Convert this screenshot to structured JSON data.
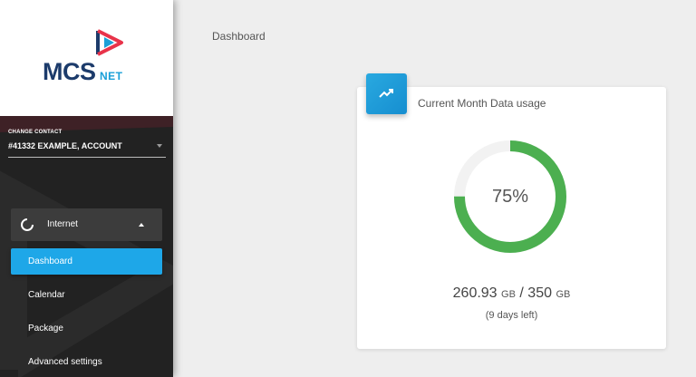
{
  "app": {
    "logo_text": "MCS",
    "logo_sub": "NET"
  },
  "sidebar": {
    "contact_label": "CHANGE CONTACT",
    "contact_value": "#41332 EXAMPLE, ACCOUNT",
    "group": {
      "label": "Internet",
      "icon": "loading-circle-icon",
      "expanded": true
    },
    "items": [
      {
        "label": "Dashboard",
        "active": true
      },
      {
        "label": "Calendar",
        "active": false
      },
      {
        "label": "Package",
        "active": false
      },
      {
        "label": "Advanced settings",
        "active": false
      }
    ]
  },
  "main": {
    "breadcrumb": "Dashboard",
    "card": {
      "title": "Current Month Data usage",
      "icon": "trending-up-icon",
      "percent_label": "75%",
      "percent_value": 0.75,
      "used": "260.93",
      "used_unit": "GB",
      "separator": "/",
      "total": "350",
      "total_unit": "GB",
      "days_left": "(9 days left)"
    }
  },
  "colors": {
    "accent": "#1ea7e8",
    "gauge": "#4caf50",
    "gauge_track": "#f2f2f2",
    "brand_dark": "#1c3b6b",
    "brand_light": "#1aa0d8",
    "sidebar_bg": "#222222"
  }
}
